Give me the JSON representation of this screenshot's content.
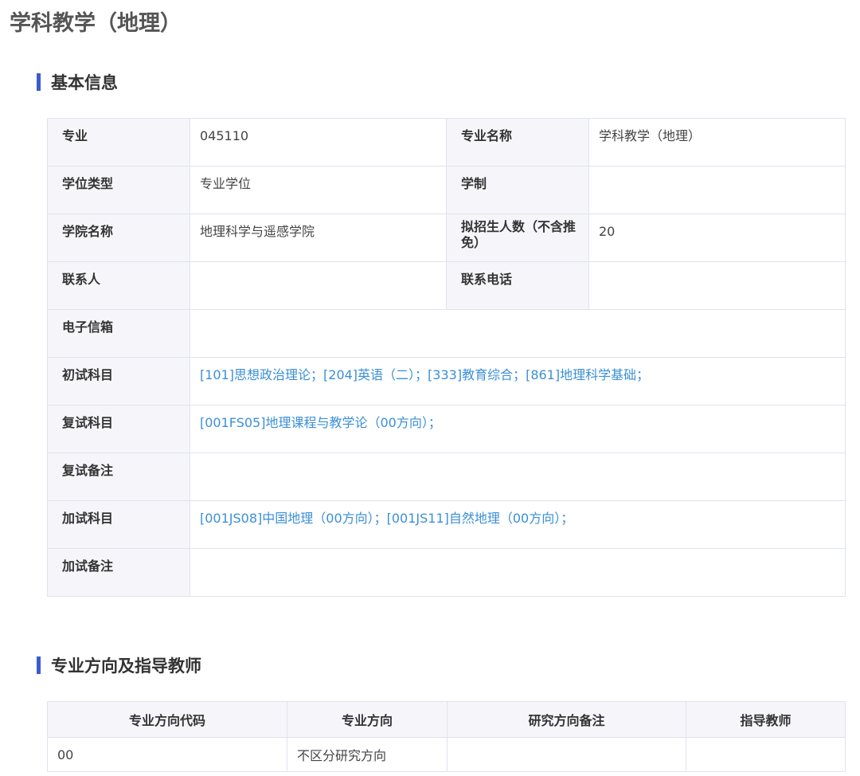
{
  "page_title": "学科教学（地理）",
  "sections": {
    "basic_info": "基本信息",
    "directions": "专业方向及指导教师"
  },
  "info": {
    "major_label": "专业",
    "major_value": "045110",
    "major_name_label": "专业名称",
    "major_name_value": "学科教学（地理）",
    "degree_type_label": "学位类型",
    "degree_type_value": "专业学位",
    "duration_label": "学制",
    "duration_value": "",
    "college_label": "学院名称",
    "college_value": "地理科学与遥感学院",
    "enroll_label": "拟招生人数（不含推免）",
    "enroll_value": "20",
    "contact_label": "联系人",
    "contact_value": "",
    "phone_label": "联系电话",
    "phone_value": "",
    "email_label": "电子信箱",
    "email_value": "",
    "prelim_label": "初试科目",
    "prelim_value": "[101]思想政治理论；[204]英语（二）；[333]教育综合；[861]地理科学基础；",
    "retest_label": "复试科目",
    "retest_value": "[001FS05]地理课程与教学论（00方向）；",
    "retest_note_label": "复试备注",
    "retest_note_value": "",
    "extra_label": "加试科目",
    "extra_value": "[001JS08]中国地理（00方向）；[001JS11]自然地理（00方向）；",
    "extra_note_label": "加试备注",
    "extra_note_value": ""
  },
  "directions_table": {
    "headers": [
      "专业方向代码",
      "专业方向",
      "研究方向备注",
      "指导教师"
    ],
    "rows": [
      [
        "00",
        "不区分研究方向",
        "",
        ""
      ]
    ]
  },
  "colors": {
    "accent_bar": "#3c5bd1",
    "link_text": "#3b8fd6",
    "label_bg": "#f6f6fa",
    "border": "#dfe3ee"
  }
}
